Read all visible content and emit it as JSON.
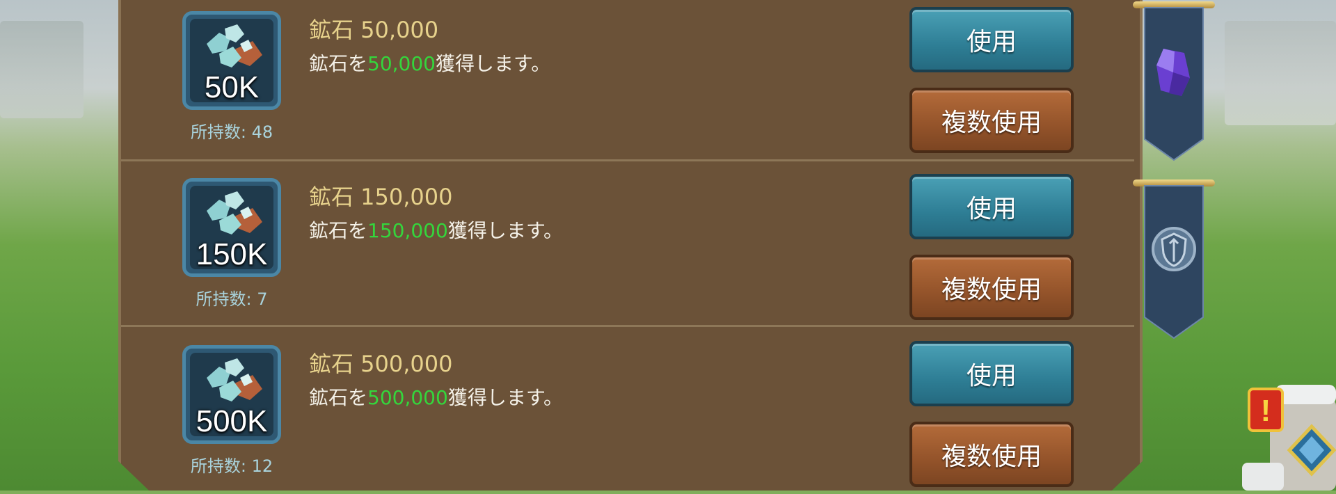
{
  "items": [
    {
      "icon": "ore-icon",
      "quantity_label": "50K",
      "owned": "所持数: 48",
      "title": "鉱石 50,000",
      "desc_prefix": "鉱石を",
      "desc_amount": "50,000",
      "desc_suffix": "獲得します。",
      "use_label": "使用",
      "multi_use_label": "複数使用"
    },
    {
      "icon": "ore-icon",
      "quantity_label": "150K",
      "owned": "所持数: 7",
      "title": "鉱石 150,000",
      "desc_prefix": "鉱石を",
      "desc_amount": "150,000",
      "desc_suffix": "獲得します。",
      "use_label": "使用",
      "multi_use_label": "複数使用"
    },
    {
      "icon": "ore-icon",
      "quantity_label": "500K",
      "owned": "所持数: 12",
      "title": "鉱石 500,000",
      "desc_prefix": "鉱石を",
      "desc_amount": "500,000",
      "desc_suffix": "獲得します。",
      "use_label": "使用",
      "multi_use_label": "複数使用"
    }
  ],
  "side_tabs": [
    {
      "icon": "purple-gem-icon"
    },
    {
      "icon": "shield-emblem-icon"
    }
  ],
  "quest_button": {
    "icon": "quest-alert-icon",
    "alert": "!"
  },
  "colors": {
    "panel": "#6b5238",
    "title": "#e7d28c",
    "highlight": "#34d63c",
    "use_button": "#2e7e95",
    "multi_use_button": "#93532a",
    "owned_text": "#a9d3dc"
  }
}
